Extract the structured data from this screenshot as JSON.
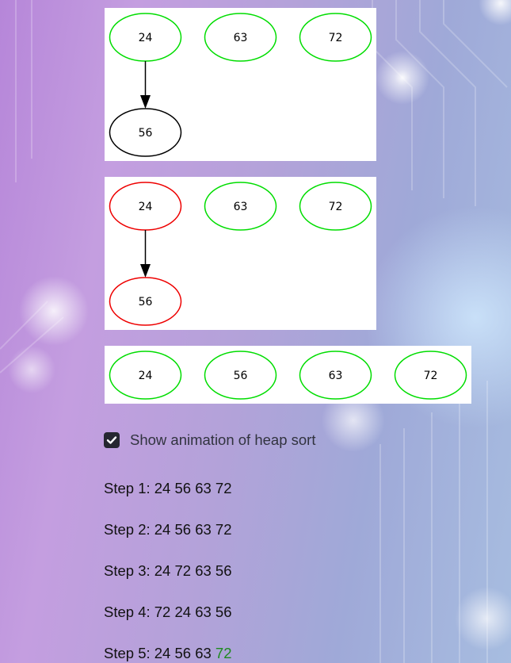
{
  "graphs": [
    {
      "nodes": [
        {
          "label": "24",
          "color": "#00dd00"
        },
        {
          "label": "63",
          "color": "#00dd00"
        },
        {
          "label": "72",
          "color": "#00dd00"
        },
        {
          "label": "56",
          "color": "#000000"
        }
      ],
      "edge": {
        "from": "24",
        "to": "56"
      }
    },
    {
      "nodes": [
        {
          "label": "24",
          "color": "#ee0000"
        },
        {
          "label": "63",
          "color": "#00dd00"
        },
        {
          "label": "72",
          "color": "#00dd00"
        },
        {
          "label": "56",
          "color": "#ee0000"
        }
      ],
      "edge": {
        "from": "24",
        "to": "56"
      }
    },
    {
      "nodes": [
        {
          "label": "24",
          "color": "#00dd00"
        },
        {
          "label": "56",
          "color": "#00dd00"
        },
        {
          "label": "63",
          "color": "#00dd00"
        },
        {
          "label": "72",
          "color": "#00dd00"
        }
      ]
    }
  ],
  "checkbox": {
    "label": "Show animation of heap sort",
    "checked": true
  },
  "steps": [
    {
      "prefix": "Step 1: 24 56 63 72",
      "highlight": ""
    },
    {
      "prefix": "Step 2: 24 56 63 72",
      "highlight": ""
    },
    {
      "prefix": "Step 3: 24 72 63 56",
      "highlight": ""
    },
    {
      "prefix": "Step 4: 72 24 63 56",
      "highlight": ""
    },
    {
      "prefix": "Step 5: 24 56 63 ",
      "highlight": "72"
    }
  ],
  "colors": {
    "sorted_green": "#00dd00",
    "swap_red": "#ee0000",
    "highlight_text": "#1e8a1e"
  }
}
